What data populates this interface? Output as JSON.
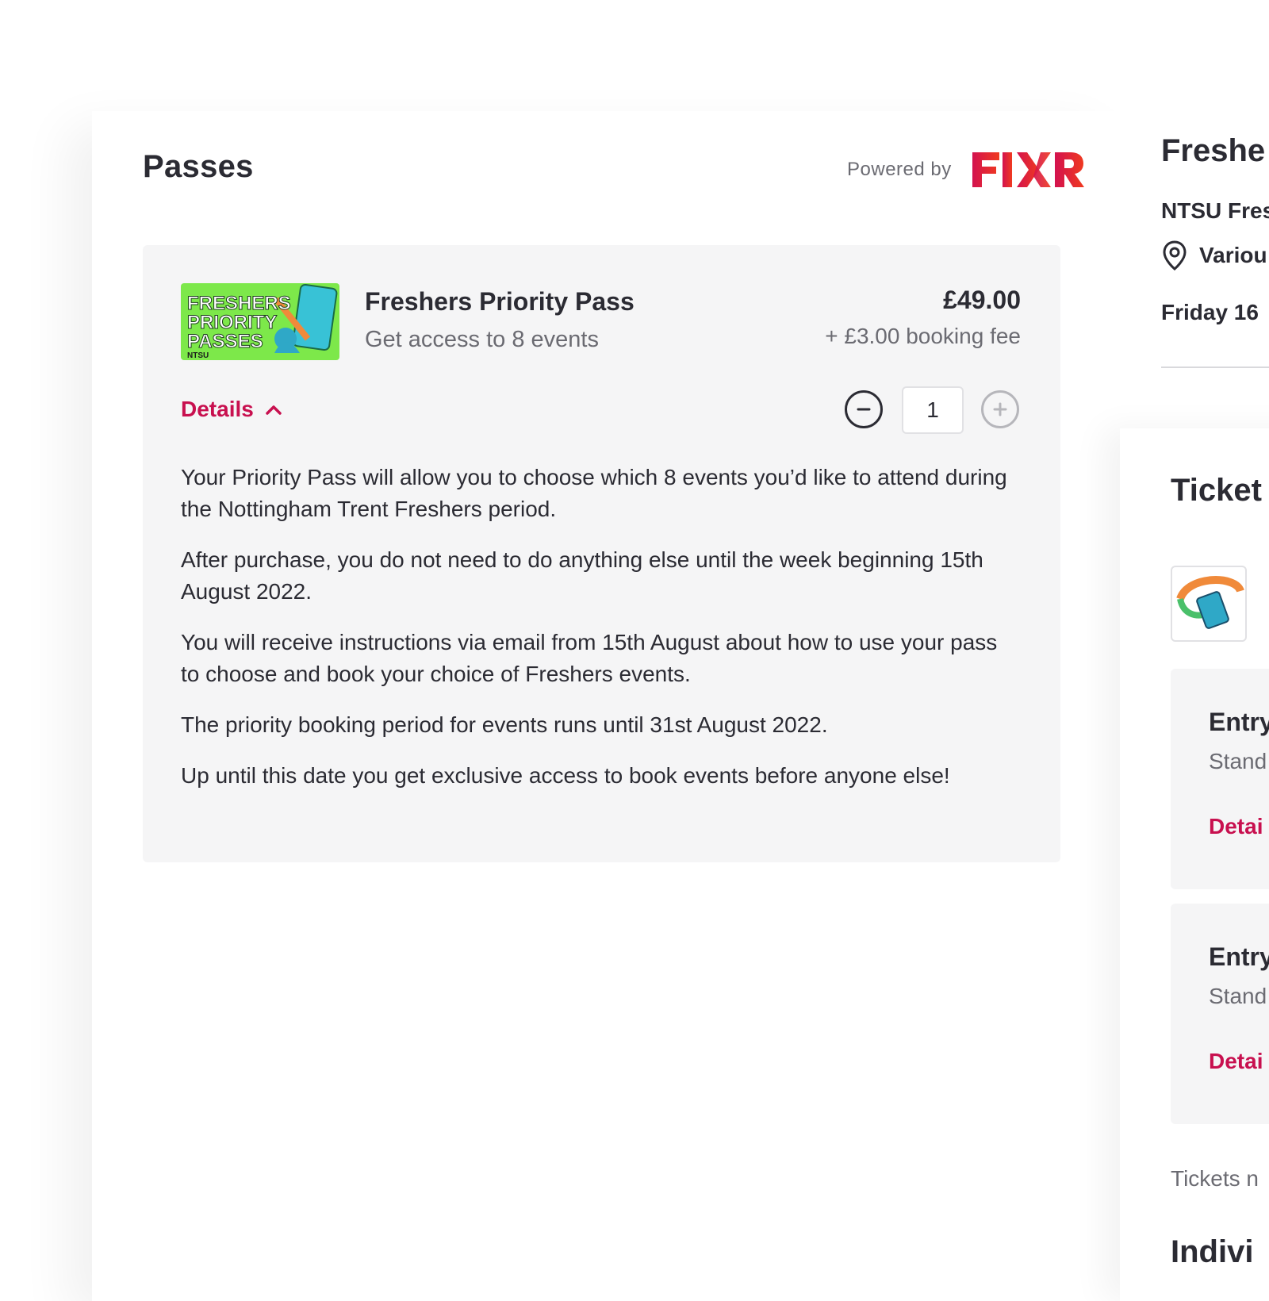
{
  "passes_section": {
    "title": "Passes",
    "powered_by": "Powered by",
    "brand_logo": "FIXR",
    "brand_color": "#e31b4e"
  },
  "pass": {
    "name": "Freshers Priority Pass",
    "subtitle": "Get access to 8 events",
    "price": "£49.00",
    "fee": "+ £3.00 booking fee",
    "thumbnail_text": [
      "FRESHERS",
      "PRIORITY",
      "PASSES"
    ],
    "thumbnail_logo": "NTSU",
    "details_label": "Details",
    "quantity": "1",
    "description": [
      "Your Priority Pass will allow you to choose which 8 events you’d like to attend during the Nottingham Trent Freshers period.",
      "After purchase, you do not need to do anything else until the week beginning 15th August 2022.",
      "You will receive instructions via email from 15th August about how to use your pass to choose and book your choice of Freshers events.",
      "The priority booking period for events runs until 31st August 2022.",
      "Up until this date you get exclusive access to book events before anyone else!"
    ]
  },
  "right_column": {
    "title": "Freshe",
    "organiser": "NTSU Fres",
    "location": "Variou",
    "date": "Friday 16",
    "tickets_heading": "Ticket",
    "cards": [
      {
        "name": "Entry",
        "type": "Stand",
        "details": "Detai"
      },
      {
        "name": "Entry",
        "type": "Stand",
        "details": "Detai"
      }
    ],
    "note": "Tickets n",
    "indiv_heading": "Indivi"
  },
  "colors": {
    "accent": "#c8104f",
    "card_bg": "#f5f5f6",
    "text": "#2b2b33",
    "muted": "#6b6b72",
    "thumb_green": "#7de84a"
  },
  "icons": {
    "details_chevron": "chevron-up-icon",
    "minus": "minus-circle-icon",
    "plus": "plus-circle-icon",
    "location": "location-pin-icon"
  }
}
